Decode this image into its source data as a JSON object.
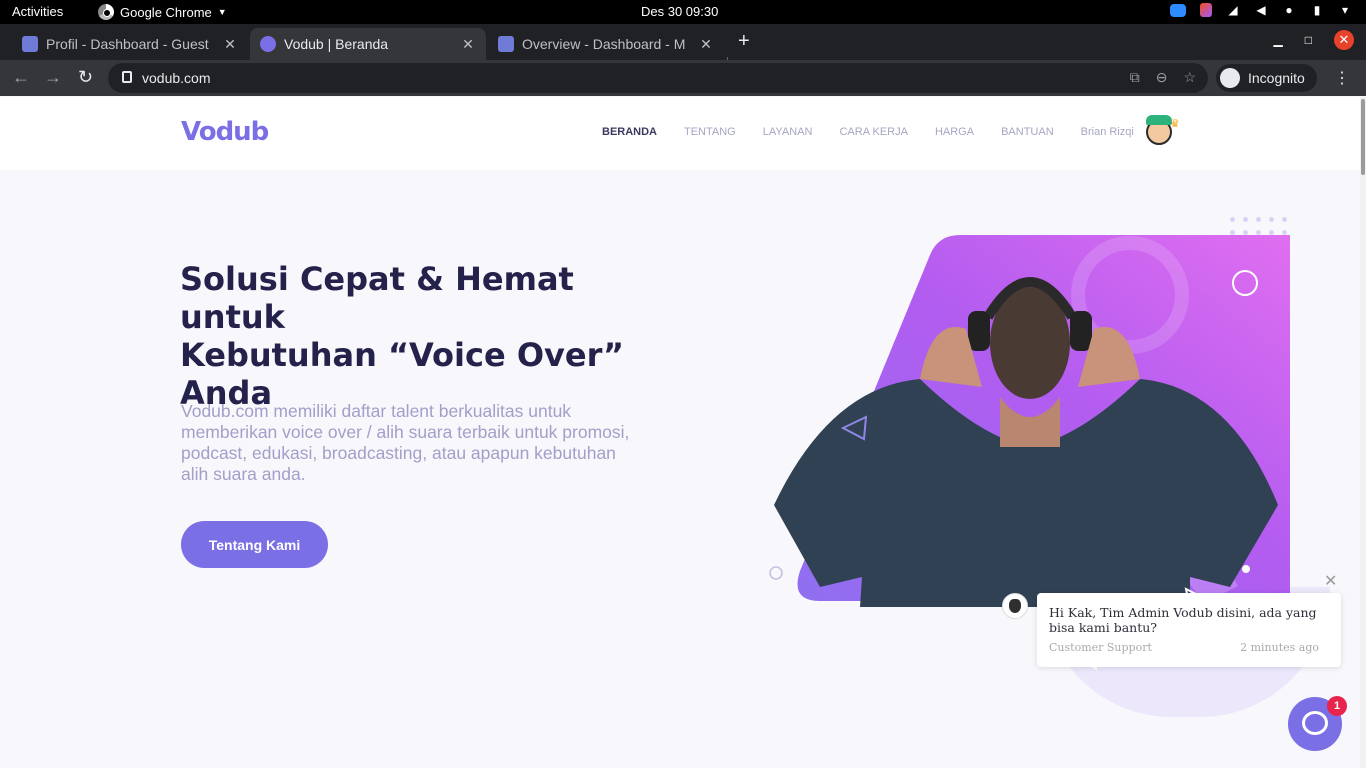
{
  "system": {
    "activities": "Activities",
    "app_name": "Google Chrome",
    "clock": "Des 30  09:30"
  },
  "browser": {
    "tabs": [
      {
        "title": "Profil - Dashboard - Guest",
        "active": false
      },
      {
        "title": "Vodub | Beranda",
        "active": true
      },
      {
        "title": "Overview - Dashboard - M",
        "active": false
      }
    ],
    "url": "vodub.com",
    "incognito_label": "Incognito"
  },
  "site": {
    "logo": "Vodub",
    "nav": [
      "BERANDA",
      "TENTANG",
      "LAYANAN",
      "CARA KERJA",
      "HARGA",
      "BANTUAN"
    ],
    "user_name": "Brian Rizqi",
    "hero": {
      "title_line1": "Solusi Cepat & Hemat untuk",
      "title_line2": "Kebutuhan “Voice Over”",
      "title_line3": "Anda",
      "description": "Vodub.com memiliki daftar talent berkualitas untuk memberikan voice over / alih suara terbaik untuk promosi, podcast, edukasi, broadcasting, atau apapun kebutuhan alih suara anda.",
      "cta": "Tentang Kami"
    },
    "colors": {
      "accent": "#7b6fe6",
      "heading": "#24214a",
      "muted": "#a29fc8"
    }
  },
  "chat": {
    "message": "Hi Kak, Tim Admin Vodub disini, ada yang bisa kami bantu?",
    "sender": "Customer Support",
    "time": "2 minutes ago",
    "unread": "1"
  }
}
